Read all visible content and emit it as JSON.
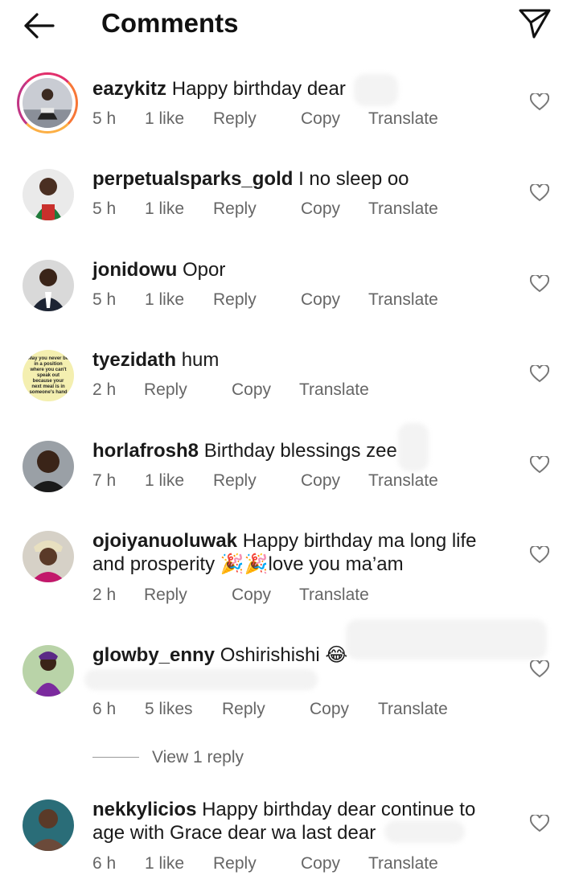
{
  "header": {
    "title": "Comments"
  },
  "comments": [
    {
      "username": "eazykitz",
      "text": "Happy birthday dear",
      "time": "5 h",
      "likes": "1 like",
      "reply": "Reply",
      "copy": "Copy",
      "translate": "Translate"
    },
    {
      "username": "perpetualsparks_gold",
      "text": "I no sleep oo",
      "time": "5 h",
      "likes": "1 like",
      "reply": "Reply",
      "copy": "Copy",
      "translate": "Translate"
    },
    {
      "username": "jonidowu",
      "text": "Opor",
      "time": "5 h",
      "likes": "1 like",
      "reply": "Reply",
      "copy": "Copy",
      "translate": "Translate"
    },
    {
      "username": "tyezidath",
      "text": "hum",
      "time": "2 h",
      "reply": "Reply",
      "copy": "Copy",
      "translate": "Translate",
      "avatar_text": "May you never be in a position where you can't speak out because your next meal is in someone's hand"
    },
    {
      "username": "horlafrosh8",
      "text": "Birthday blessings zee",
      "time": "7 h",
      "likes": "1 like",
      "reply": "Reply",
      "copy": "Copy",
      "translate": "Translate"
    },
    {
      "username": "ojoiyanuoluwak",
      "text": "Happy birthday ma long life",
      "text2": "and prosperity 🎉🎉love you ma’am",
      "time": "2 h",
      "reply": "Reply",
      "copy": "Copy",
      "translate": "Translate"
    },
    {
      "username": "glowby_enny",
      "text": "Oshirishishi 😂",
      "time": "6 h",
      "likes": "5 likes",
      "reply": "Reply",
      "copy": "Copy",
      "translate": "Translate"
    },
    {
      "username": "nekkylicios",
      "text": "Happy birthday dear continue to",
      "text2": "age with Grace dear wa last dear",
      "time": "6 h",
      "likes": "1 like",
      "reply": "Reply",
      "copy": "Copy",
      "translate": "Translate"
    }
  ],
  "view_replies": "View 1 reply",
  "icons": {
    "back": "arrow-left-icon",
    "share": "send-icon",
    "like": "heart-icon"
  }
}
